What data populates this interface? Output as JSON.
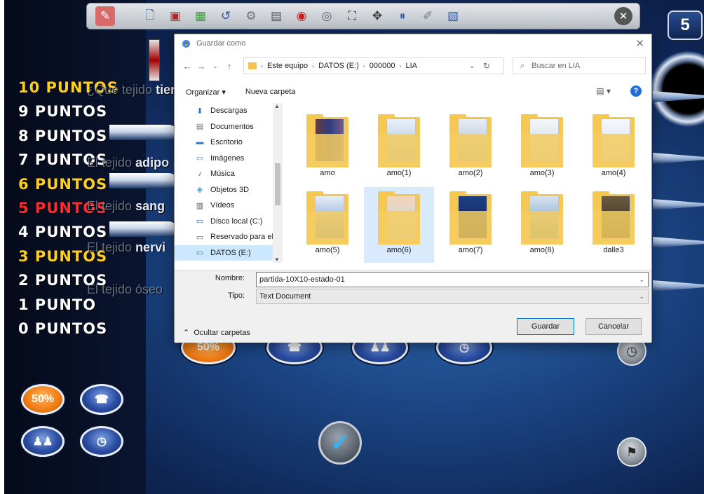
{
  "game": {
    "level": "5",
    "points": [
      {
        "label": "10 PUNTOS",
        "color": "yellow"
      },
      {
        "label": "9 PUNTOS",
        "color": "white"
      },
      {
        "label": "8 PUNTOS",
        "color": "white"
      },
      {
        "label": "7 PUNTOS",
        "color": "white"
      },
      {
        "label": "6 PUNTOS",
        "color": "yellow"
      },
      {
        "label": "5 PUNTOS",
        "color": "red"
      },
      {
        "label": "4 PUNTOS",
        "color": "white"
      },
      {
        "label": "3 PUNTOS",
        "color": "yellow"
      },
      {
        "label": "2 PUNTOS",
        "color": "white"
      },
      {
        "label": "1 PUNTO",
        "color": "white"
      },
      {
        "label": "0 PUNTOS",
        "color": "white"
      }
    ],
    "question_fragment": "¿Qué tejido tien",
    "question_fragment_faded": "¿Qué tejido",
    "question_fragment_visible": "tien",
    "answers": [
      {
        "faded": "El tejido",
        "visible": "adipo"
      },
      {
        "faded": "El tejido",
        "visible": "sang"
      },
      {
        "faded": "El tejido",
        "visible": "nervi"
      },
      {
        "faded": "El tejido óseo",
        "visible": "óseo"
      }
    ],
    "lifeline_50": "50%",
    "check": "✓"
  },
  "dialog": {
    "title": "Guardar como",
    "address": {
      "crumbs": [
        "Este equipo",
        "DATOS (E:)",
        "000000",
        "LIA"
      ]
    },
    "search_placeholder": "Buscar en LIA",
    "cmd": {
      "organize": "Organizar ▾",
      "new_folder": "Nueva carpeta"
    },
    "nav_items": [
      {
        "label": "Descargas",
        "icon": "download-icon"
      },
      {
        "label": "Documentos",
        "icon": "documents-icon"
      },
      {
        "label": "Escritorio",
        "icon": "desktop-icon"
      },
      {
        "label": "Imágenes",
        "icon": "images-icon"
      },
      {
        "label": "Música",
        "icon": "music-icon"
      },
      {
        "label": "Objetos 3D",
        "icon": "3d-objects-icon"
      },
      {
        "label": "Vídeos",
        "icon": "videos-icon"
      },
      {
        "label": "Disco local (C:)",
        "icon": "drive-icon"
      },
      {
        "label": "Reservado para el",
        "icon": "drive-icon"
      },
      {
        "label": "DATOS (E:)",
        "icon": "drive-icon",
        "selected": true
      }
    ],
    "files": [
      {
        "name": "amo"
      },
      {
        "name": "amo(1)"
      },
      {
        "name": "amo(2)"
      },
      {
        "name": "amo(3)"
      },
      {
        "name": "amo(4)"
      },
      {
        "name": "amo(5)"
      },
      {
        "name": "amo(6)",
        "selected": true
      },
      {
        "name": "amo(7)"
      },
      {
        "name": "amo(8)"
      },
      {
        "name": "dalle3"
      }
    ],
    "filename_label": "Nombre:",
    "filename_value": "partida-10X10-estado-01",
    "type_label": "Tipo:",
    "type_value": "Text Document",
    "hide_folders": "Ocultar carpetas",
    "save_button": "Guardar",
    "cancel_button": "Cancelar"
  }
}
